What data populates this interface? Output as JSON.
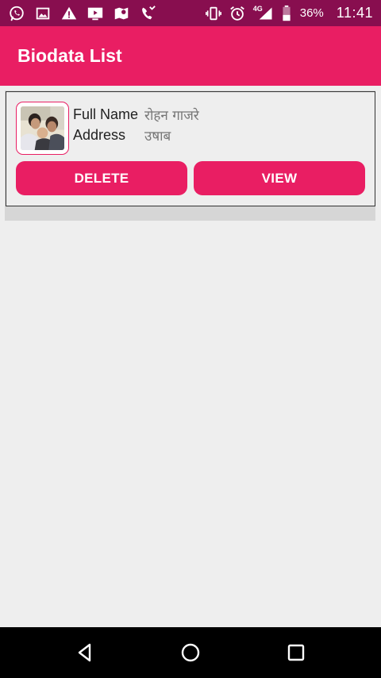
{
  "status_bar": {
    "battery_percent": "36%",
    "time": "11:41",
    "network_label": "4G",
    "icons": [
      "whatsapp-icon",
      "image-icon",
      "warning-icon",
      "video-icon",
      "maps-icon",
      "missed-call-icon",
      "vibrate-icon",
      "alarm-icon",
      "signal-icon",
      "battery-icon"
    ]
  },
  "app_bar": {
    "title": "Biodata List"
  },
  "colors": {
    "primary": "#e91e63",
    "status_bar": "#880e4f",
    "background": "#eeeeee"
  },
  "list": {
    "items": [
      {
        "avatar": "profile-photo",
        "name_label": "Full Name",
        "name_value": "रोहन गाजरे",
        "address_label": "Address",
        "address_value": "उषाब",
        "delete_label": "DELETE",
        "view_label": "VIEW"
      }
    ]
  },
  "nav_bar": {
    "icons": [
      "back-icon",
      "home-icon",
      "recents-icon"
    ]
  }
}
